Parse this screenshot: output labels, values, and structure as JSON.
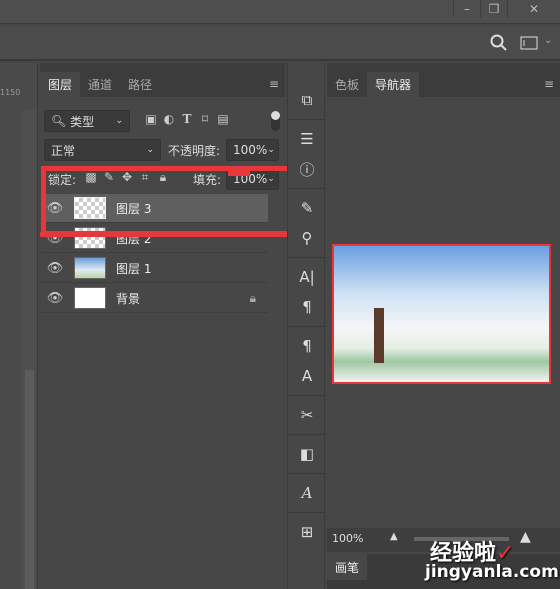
{
  "window": {
    "minimize": "–",
    "restore": "❐",
    "close": "✕"
  },
  "optbar": {
    "search_icon": "search-icon",
    "workspace_icon": "workspace-icon"
  },
  "ruler": {
    "value": "1150"
  },
  "layers_panel": {
    "tabs": [
      "图层",
      "通道",
      "路径"
    ],
    "filter": {
      "value": "类型"
    },
    "blend_mode": "正常",
    "opacity_label": "不透明度:",
    "opacity": "100%",
    "lock_label": "锁定:",
    "fill_label": "填充:",
    "fill": "100%",
    "layers": [
      {
        "name": "图层 3",
        "thumb": "transparent",
        "selected": true
      },
      {
        "name": "图层 2",
        "thumb": "transparent",
        "selected": false
      },
      {
        "name": "图层 1",
        "thumb": "photo",
        "selected": false
      },
      {
        "name": "背景",
        "thumb": "white",
        "locked": true,
        "selected": false
      }
    ]
  },
  "navigator_panel": {
    "tabs": [
      "色板",
      "导航器"
    ],
    "zoom": "100%"
  },
  "brush_panel": {
    "tab": "画笔"
  },
  "watermark": {
    "text": "经验啦",
    "url": "jingyanla.com"
  },
  "colors": {
    "highlight": "#e8363b"
  }
}
